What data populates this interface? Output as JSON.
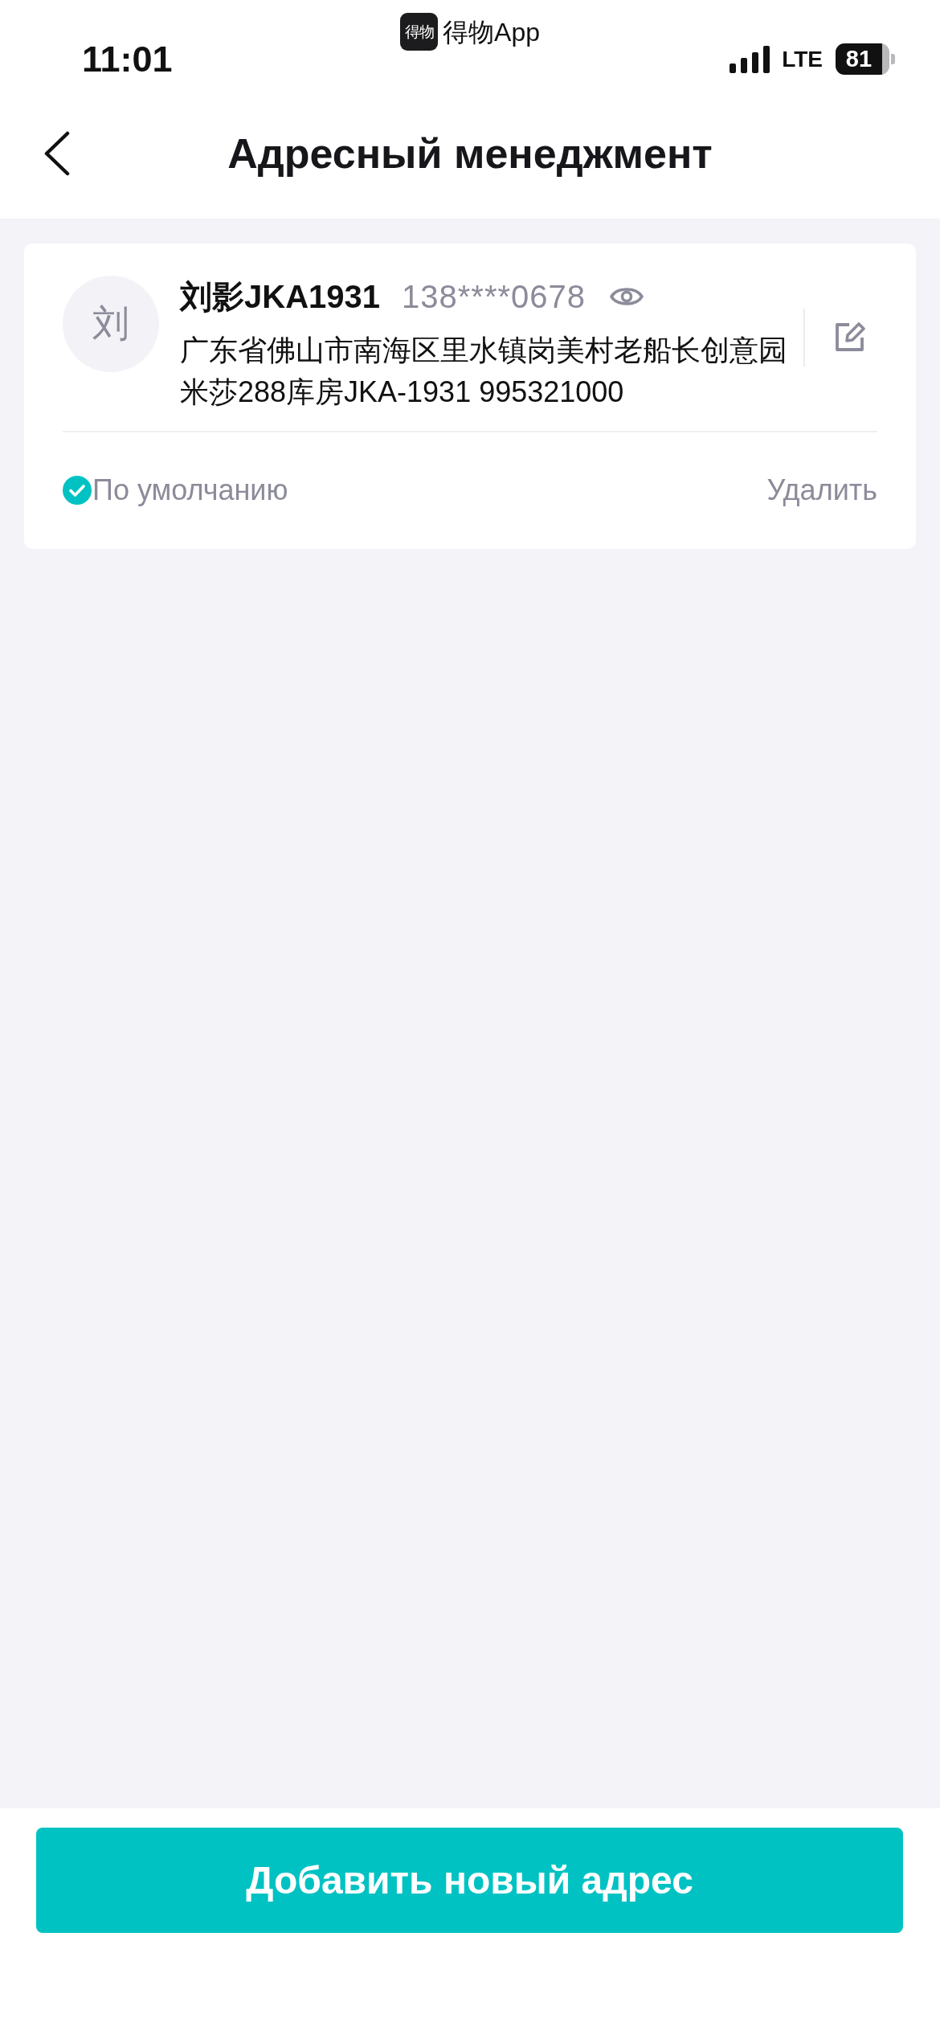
{
  "status_bar": {
    "time": "11:01",
    "app_logo": "得物",
    "back_app": "得物App",
    "network": "LTE",
    "battery": "81"
  },
  "header": {
    "title": "Адресный менеджмент"
  },
  "addresses": [
    {
      "avatar": "刘",
      "name": "刘影JKA1931",
      "phone": "138****0678",
      "address": "广东省佛山市南海区里水镇岗美村老船长创意园米莎288库房JKA-1931 995321000",
      "default": true,
      "default_label": "По умолчанию",
      "delete_label": "Удалить"
    }
  ],
  "add_button": {
    "label": "Добавить новый адрес"
  }
}
